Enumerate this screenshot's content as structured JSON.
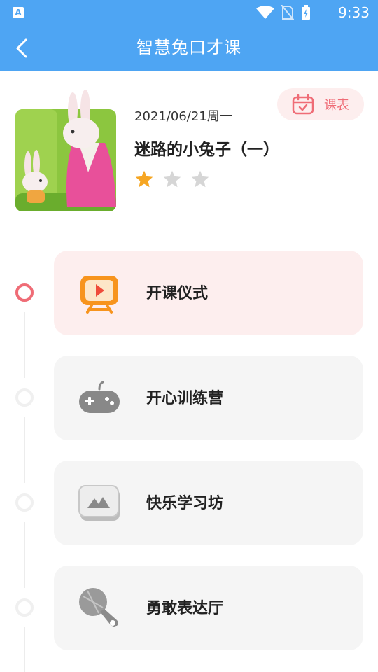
{
  "status_bar": {
    "time": "9:33",
    "app_icon_letter": "A"
  },
  "header": {
    "title": "智慧兔口才课"
  },
  "lesson": {
    "date": "2021/06/21周一",
    "title": "迷路的小兔子（一）",
    "rating": 1,
    "max_rating": 3,
    "schedule_label": "课表"
  },
  "sessions": [
    {
      "label": "开课仪式",
      "icon": "tv-play-icon",
      "active": true
    },
    {
      "label": "开心训练营",
      "icon": "gamepad-icon",
      "active": false
    },
    {
      "label": "快乐学习坊",
      "icon": "picture-frame-icon",
      "active": false
    },
    {
      "label": "勇敢表达厅",
      "icon": "microphone-icon",
      "active": false
    }
  ],
  "colors": {
    "header_bg": "#4ea5f3",
    "accent_red": "#ef6c76",
    "star_gold": "#f6a623",
    "star_gray": "#d6d6d6"
  }
}
